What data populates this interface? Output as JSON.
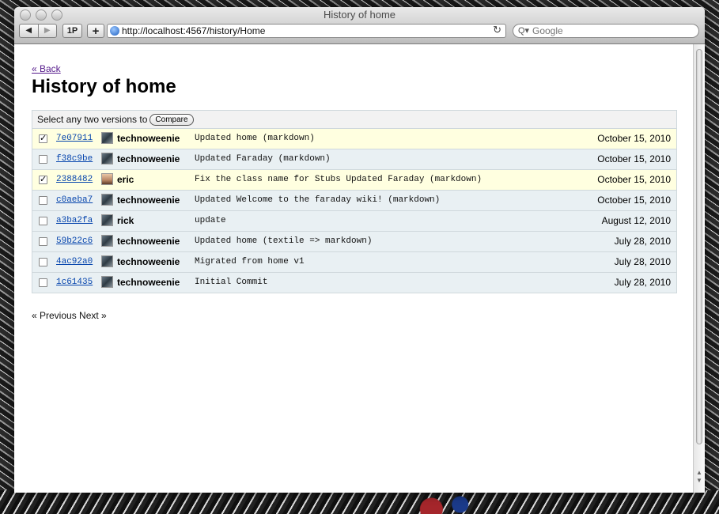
{
  "browser": {
    "window_title": "History of home",
    "one_password_label": "1P",
    "add_label": "+",
    "url": "http://localhost:4567/history/Home",
    "search_placeholder": "Google"
  },
  "page": {
    "back_link": "« Back",
    "title": "History of home",
    "select_prompt": "Select any two versions to",
    "compare_label": "Compare"
  },
  "commits": [
    {
      "checked": true,
      "sha": "7e07911",
      "author": "technoweenie",
      "message": "Updated home (markdown)",
      "date": "October 15, 2010"
    },
    {
      "checked": false,
      "sha": "f38c9be",
      "author": "technoweenie",
      "message": "Updated Faraday (markdown)",
      "date": "October 15, 2010"
    },
    {
      "checked": true,
      "sha": "2388482",
      "author": "eric",
      "message": "Fix the class name for Stubs Updated Faraday (markdown)",
      "date": "October 15, 2010"
    },
    {
      "checked": false,
      "sha": "c0aeba7",
      "author": "technoweenie",
      "message": "Updated Welcome to the faraday wiki! (markdown)",
      "date": "October 15, 2010"
    },
    {
      "checked": false,
      "sha": "a3ba2fa",
      "author": "rick",
      "message": "update",
      "date": "August 12, 2010"
    },
    {
      "checked": false,
      "sha": "59b22c6",
      "author": "technoweenie",
      "message": "Updated home (textile => markdown)",
      "date": "July 28, 2010"
    },
    {
      "checked": false,
      "sha": "4ac92a0",
      "author": "technoweenie",
      "message": "Migrated from home v1",
      "date": "July 28, 2010"
    },
    {
      "checked": false,
      "sha": "1c61435",
      "author": "technoweenie",
      "message": "Initial Commit",
      "date": "July 28, 2010"
    }
  ],
  "pagination": {
    "previous": "« Previous",
    "next": "Next »"
  },
  "colors": {
    "selected_row": "#ffffe0",
    "row": "#e9f0f3",
    "link": "#0645ad"
  }
}
